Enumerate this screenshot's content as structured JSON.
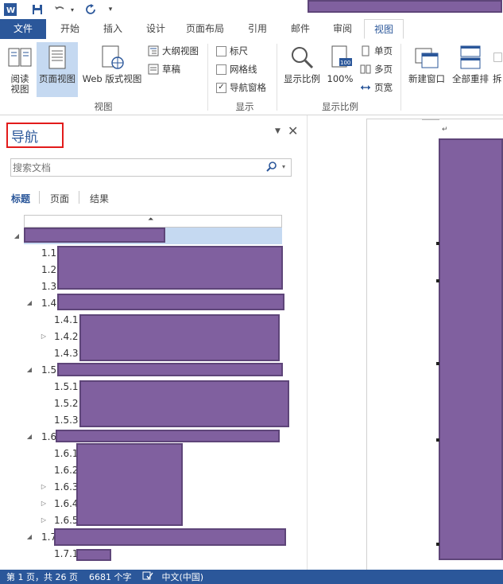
{
  "window": {
    "qat_icons": [
      "word-logo-icon",
      "save-icon",
      "undo-icon",
      "redo-icon",
      "customize-icon"
    ]
  },
  "tabs": [
    {
      "label": "文件",
      "kind": "file"
    },
    {
      "label": "开始"
    },
    {
      "label": "插入"
    },
    {
      "label": "设计"
    },
    {
      "label": "页面布局"
    },
    {
      "label": "引用"
    },
    {
      "label": "邮件"
    },
    {
      "label": "审阅"
    },
    {
      "label": "视图",
      "active": true
    }
  ],
  "ribbon": {
    "views": {
      "read_label": "阅读\n视图",
      "page_label": "页面视图",
      "web_label": "Web 版式视图",
      "outline_label": "大纲视图",
      "draft_label": "草稿",
      "group_label": "视图"
    },
    "show": {
      "ruler_label": "标尺",
      "ruler_checked": false,
      "grid_label": "网格线",
      "grid_checked": false,
      "nav_label": "导航窗格",
      "nav_checked": true,
      "group_label": "显示"
    },
    "zoom": {
      "zoom_label": "显示比例",
      "percent_label": "100%",
      "one_page_label": "单页",
      "multi_page_label": "多页",
      "page_width_label": "页宽",
      "group_label": "显示比例"
    },
    "window": {
      "new_window_label": "新建窗口",
      "arrange_all_label": "全部重排",
      "split_partial": "拆"
    }
  },
  "nav_pane": {
    "title": "导航",
    "search_placeholder": "搜索文档",
    "subtabs": [
      "标题",
      "页面",
      "结果"
    ],
    "active_subtab": 0,
    "tree": [
      {
        "num": "",
        "level": 0,
        "expander": "expanded",
        "redact_w": 178,
        "selected": true
      },
      {
        "num": "1.1",
        "level": 1,
        "expander": "none"
      },
      {
        "num": "1.2",
        "level": 1,
        "expander": "none"
      },
      {
        "num": "1.3",
        "level": 1,
        "expander": "none"
      },
      {
        "num": "1.4",
        "level": 0,
        "expander": "expanded"
      },
      {
        "num": "1.4.1",
        "level": 2,
        "expander": "none"
      },
      {
        "num": "1.4.2",
        "level": 2,
        "expander": "collapsed"
      },
      {
        "num": "1.4.3",
        "level": 2,
        "expander": "none"
      },
      {
        "num": "1.5",
        "level": 0,
        "expander": "expanded"
      },
      {
        "num": "1.5.1",
        "level": 2,
        "expander": "none"
      },
      {
        "num": "1.5.2",
        "level": 2,
        "expander": "none"
      },
      {
        "num": "1.5.3",
        "level": 2,
        "expander": "none"
      },
      {
        "num": "1.6",
        "level": 0,
        "expander": "expanded"
      },
      {
        "num": "1.6.1",
        "level": 2,
        "expander": "none"
      },
      {
        "num": "1.6.2",
        "level": 2,
        "expander": "none"
      },
      {
        "num": "1.6.3",
        "level": 2,
        "expander": "collapsed"
      },
      {
        "num": "1.6.4",
        "level": 2,
        "expander": "collapsed"
      },
      {
        "num": "1.6.5",
        "level": 2,
        "expander": "collapsed"
      },
      {
        "num": "1.7",
        "level": 0,
        "expander": "expanded"
      },
      {
        "num": "1.7.1",
        "level": 2,
        "expander": "none"
      }
    ]
  },
  "document": {
    "paragraph_mark": "↵"
  },
  "statusbar": {
    "page_info": "第 1 页，共 26 页",
    "word_count": "6681 个字",
    "language": "中文(中国)"
  },
  "colors": {
    "accent": "#2b579a",
    "redaction": "#80609f",
    "highlight_box": "#e21b1b"
  }
}
